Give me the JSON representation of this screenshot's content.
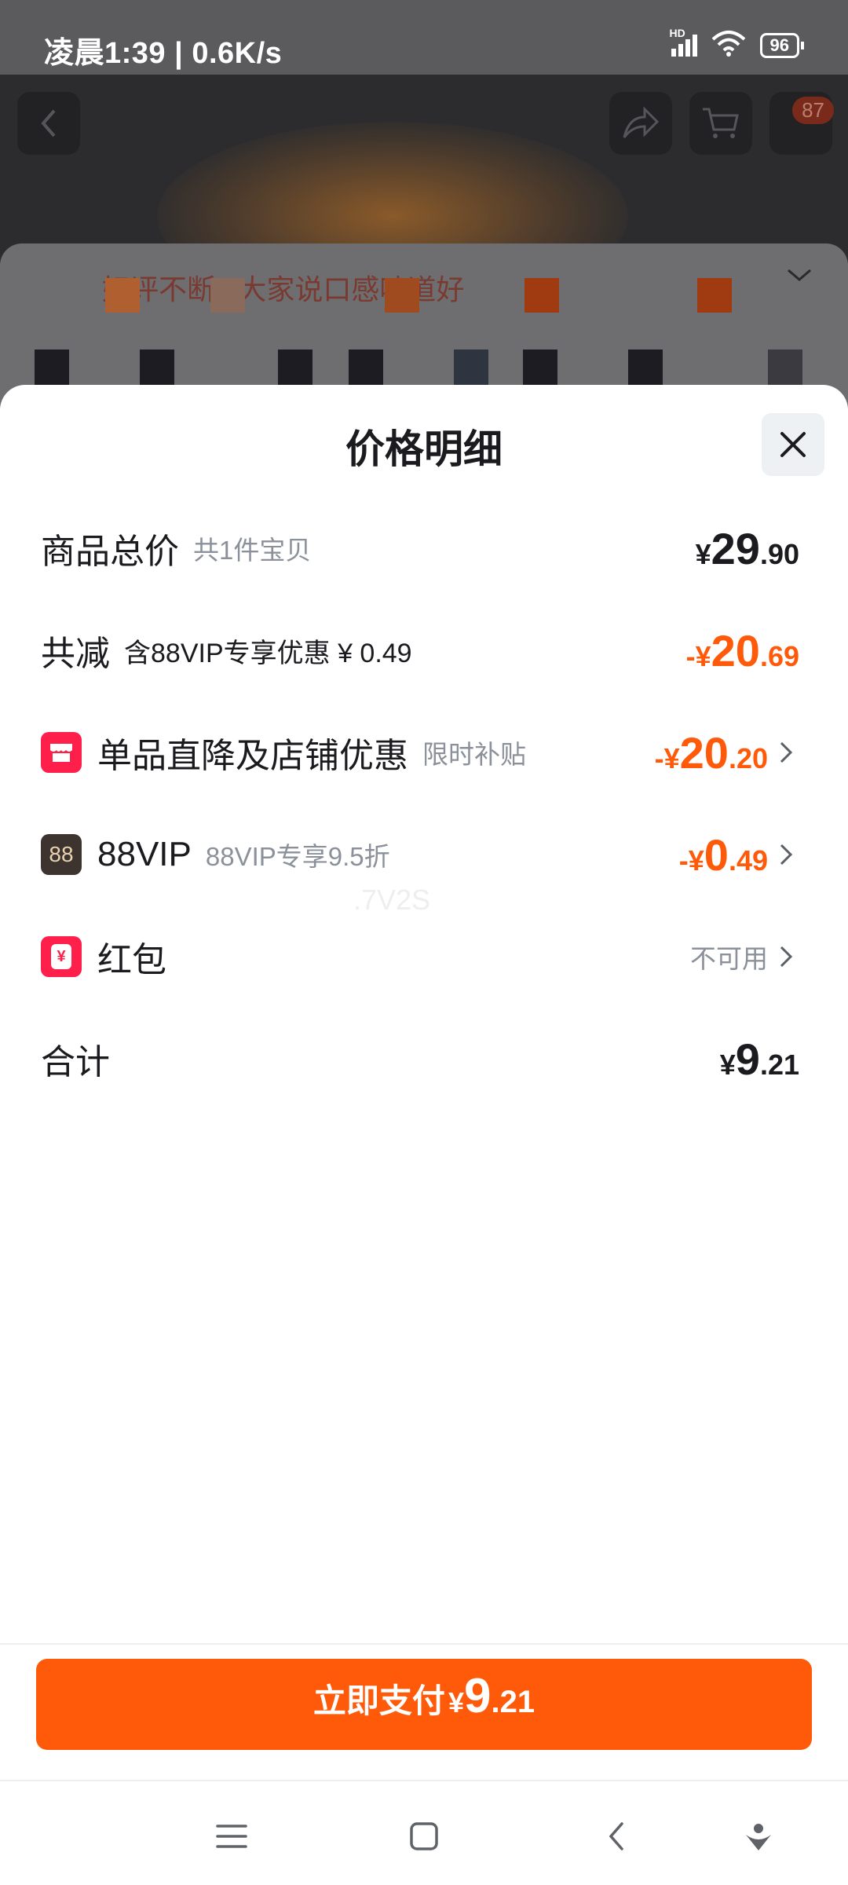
{
  "status_bar": {
    "time": "凌晨1:39",
    "speed": "0.6K/s",
    "network_label": "HD",
    "battery": "96",
    "icons": [
      "signal-icon",
      "wifi-icon",
      "battery-icon"
    ]
  },
  "background": {
    "cart_badge": "87",
    "card_text": "好评不断 | 大家说口感味道好",
    "icons": [
      "back-icon",
      "share-icon",
      "cart-icon"
    ]
  },
  "sheet": {
    "title": "价格明细",
    "rows": [
      {
        "label": "商品总价",
        "sub": "共1件宝贝",
        "currency": "¥",
        "int": "29",
        "dec": ".90"
      },
      {
        "label": "共减",
        "sub": "含88VIP专享优惠 ¥ 0.49",
        "currency": "-¥",
        "int": "20",
        "dec": ".69"
      },
      {
        "label": "单品直降及店铺优惠",
        "sub": "限时补贴",
        "currency": "-¥",
        "int": "20",
        "dec": ".20"
      },
      {
        "label": "88VIP",
        "sub": "88VIP专享9.5折",
        "currency": "-¥",
        "int": "0",
        "dec": ".49",
        "icon_text": "88"
      },
      {
        "label": "红包",
        "status": "不可用",
        "icon_text": "¥"
      },
      {
        "label": "合计",
        "currency": "¥",
        "int": "9",
        "dec": ".21"
      }
    ],
    "watermark": ".7V2S"
  },
  "pay_button": {
    "label": "立即支付",
    "currency": "¥",
    "int": "9",
    "dec": ".21"
  },
  "nav_bar": {
    "icons": [
      "menu-icon",
      "home-icon",
      "back-icon",
      "assistant-icon"
    ]
  },
  "colors": {
    "accent": "#ff5a0a",
    "text": "#1b1b1f",
    "muted": "#8b919a",
    "store_icon": "#ff1f4b",
    "vip_icon": "#3d3430"
  }
}
